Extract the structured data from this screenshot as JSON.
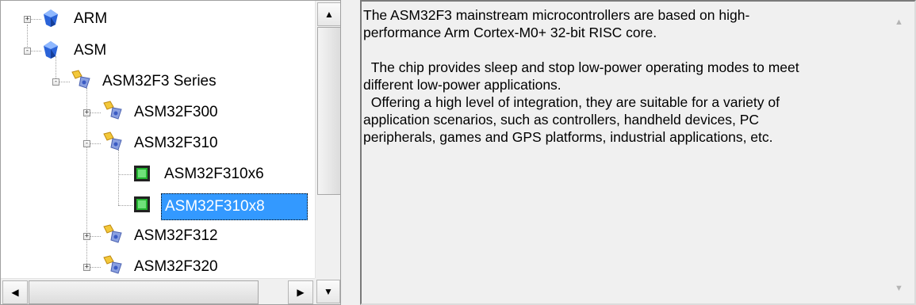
{
  "tree": {
    "nodes": [
      {
        "label": "ARM",
        "icon": "blue-gem-icon",
        "expander": "+"
      },
      {
        "label": "ASM",
        "icon": "blue-gem-icon",
        "expander": "-"
      },
      {
        "label": "ASM32F3 Series",
        "icon": "series-folder-icon",
        "expander": "-"
      },
      {
        "label": "ASM32F300",
        "icon": "series-folder-icon",
        "expander": "+"
      },
      {
        "label": "ASM32F310",
        "icon": "series-folder-icon",
        "expander": "-"
      },
      {
        "label": "ASM32F310x6",
        "icon": "chip-icon",
        "expander": ""
      },
      {
        "label": "ASM32F310x8",
        "icon": "chip-icon",
        "expander": "",
        "selected": true
      },
      {
        "label": "ASM32F312",
        "icon": "series-folder-icon",
        "expander": "+"
      },
      {
        "label": "ASM32F320",
        "icon": "series-folder-icon",
        "expander": "+"
      }
    ]
  },
  "scrollbar_glyphs": {
    "up": "▲",
    "down": "▼",
    "left": "◀",
    "right": "▶"
  },
  "description": {
    "text": "The ASM32F3 mainstream microcontrollers are based on high-\nperformance Arm Cortex-M0+ 32-bit RISC core.\n\n  The chip provides sleep and stop low-power operating modes to meet\ndifferent low-power applications.\n  Offering a high level of integration, they are suitable for a variety of\napplication scenarios, such as controllers, handheld devices, PC\nperipherals, games and GPS platforms, industrial applications, etc."
  },
  "colors": {
    "selection": "#3399ff",
    "panel_bg": "#f0f0f0"
  }
}
